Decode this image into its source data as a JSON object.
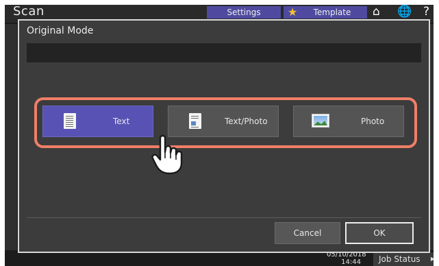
{
  "app": {
    "title": "Scan"
  },
  "topbar": {
    "settings_label": "Settings",
    "template_label": "Template",
    "icons": [
      "star-icon",
      "home-icon",
      "globe-icon",
      "help-icon"
    ]
  },
  "status": {
    "date": "05/10/2018",
    "time": "14:44",
    "job_status_label": "Job Status"
  },
  "dialog": {
    "title": "Original Mode",
    "options": [
      {
        "label": "Text",
        "icon": "text-document-icon",
        "selected": true
      },
      {
        "label": "Text/Photo",
        "icon": "text-photo-document-icon",
        "selected": false
      },
      {
        "label": "Photo",
        "icon": "photo-icon",
        "selected": false
      }
    ],
    "cancel_label": "Cancel",
    "ok_label": "OK"
  },
  "colors": {
    "selected": "#5752b4",
    "highlight": "#f07f68",
    "tab": "#4f4aa0",
    "star": "#f3c330"
  }
}
